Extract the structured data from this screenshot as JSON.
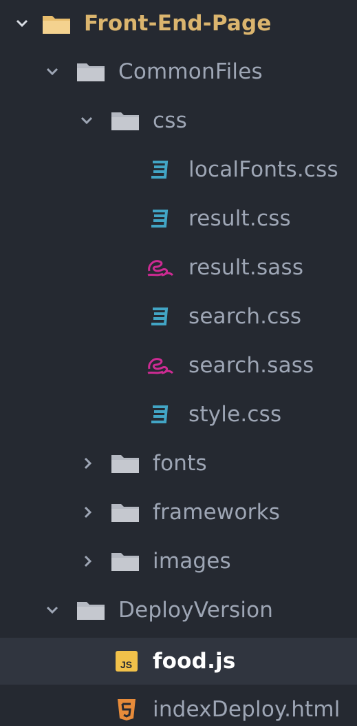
{
  "explorer": {
    "root": {
      "label": "Front-End-Page",
      "expanded": true,
      "icon": "folder-open-icon",
      "color": "#dbb56e"
    },
    "common_files": {
      "label": "CommonFiles",
      "expanded": true,
      "icon": "folder-icon"
    },
    "css_folder": {
      "label": "css",
      "expanded": true,
      "icon": "folder-icon"
    },
    "css_files": [
      {
        "label": "localFonts.css",
        "icon": "css-file-icon"
      },
      {
        "label": "result.css",
        "icon": "css-file-icon"
      },
      {
        "label": "result.sass",
        "icon": "sass-file-icon"
      },
      {
        "label": "search.css",
        "icon": "css-file-icon"
      },
      {
        "label": "search.sass",
        "icon": "sass-file-icon"
      },
      {
        "label": "style.css",
        "icon": "css-file-icon"
      }
    ],
    "collapsed_folders": [
      {
        "label": "fonts",
        "expanded": false,
        "icon": "folder-icon"
      },
      {
        "label": "frameworks",
        "expanded": false,
        "icon": "folder-icon"
      },
      {
        "label": "images",
        "expanded": false,
        "icon": "folder-icon"
      }
    ],
    "deploy_version": {
      "label": "DeployVersion",
      "expanded": true,
      "icon": "folder-icon"
    },
    "deploy_files": [
      {
        "label": "food.js",
        "icon": "js-file-icon",
        "selected": true
      },
      {
        "label": "indexDeploy.html",
        "icon": "html-file-icon",
        "selected": false
      }
    ]
  },
  "colors": {
    "background": "#252931",
    "selection": "#30353f",
    "css_icon": "#42a5c5",
    "sass_icon": "#cd2b93",
    "js_icon": "#f1c14a",
    "html_icon": "#e78b3a",
    "folder": "#b5b9c2",
    "root_folder": "#e8bd6d"
  }
}
